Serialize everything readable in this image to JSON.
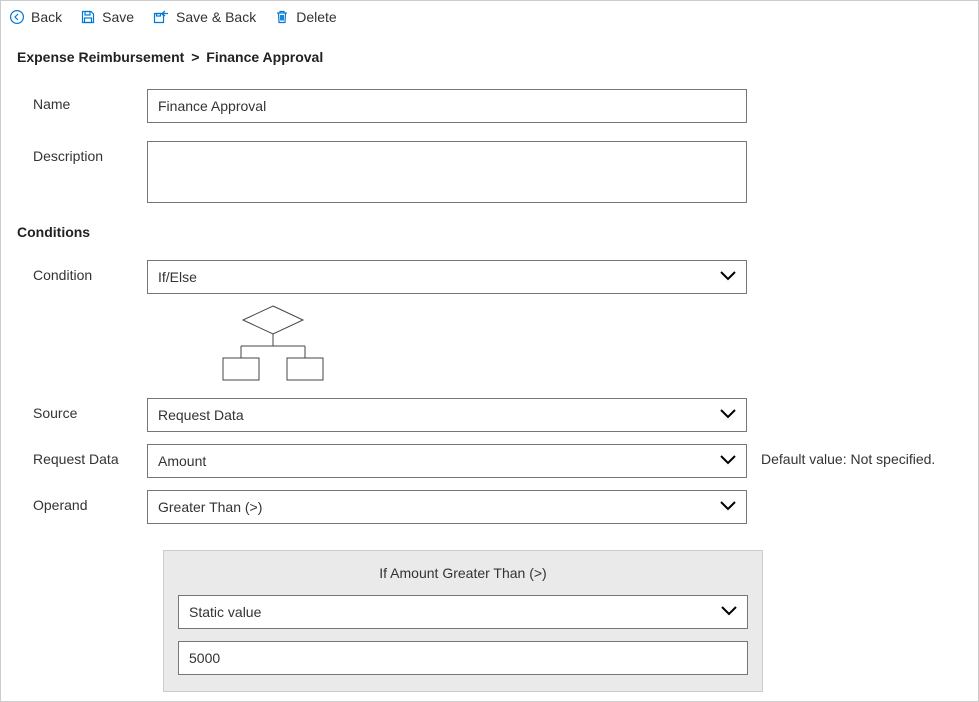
{
  "toolbar": {
    "back": "Back",
    "save": "Save",
    "save_back": "Save & Back",
    "delete": "Delete"
  },
  "breadcrumb": {
    "parent": "Expense Reimbursement",
    "sep": ">",
    "current": "Finance Approval"
  },
  "form": {
    "name_label": "Name",
    "name_value": "Finance Approval",
    "description_label": "Description",
    "description_value": ""
  },
  "conditions": {
    "header": "Conditions",
    "condition_label": "Condition",
    "condition_value": "If/Else",
    "source_label": "Source",
    "source_value": "Request Data",
    "request_data_label": "Request Data",
    "request_data_value": "Amount",
    "request_data_hint": "Default value: Not specified.",
    "operand_label": "Operand",
    "operand_value": "Greater Than (>)"
  },
  "panel": {
    "title": "If Amount Greater Than (>)",
    "value_type": "Static value",
    "value": "5000"
  }
}
